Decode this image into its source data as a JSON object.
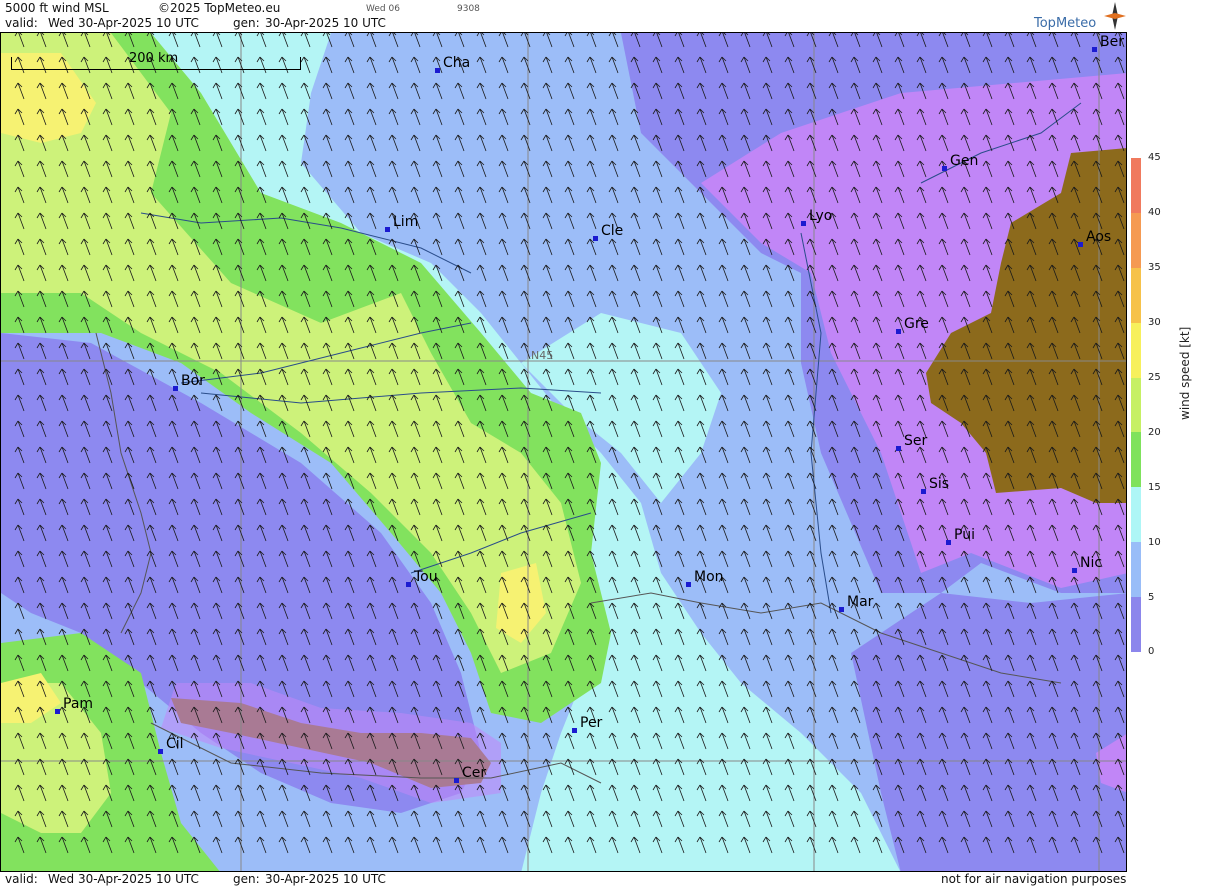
{
  "header": {
    "level": "5000 ft wind MSL",
    "copyright": "©2025 TopMeteo.eu",
    "day_short": "Wed 06",
    "code": "9308",
    "valid_label": "valid:",
    "valid_value": "Wed  30-Apr-2025  10 UTC",
    "gen_label": "gen:",
    "gen_value": "30-Apr-2025 10 UTC"
  },
  "footer": {
    "valid_label": "valid:",
    "valid_value": "Wed  30-Apr-2025  10 UTC",
    "gen_label": "gen:",
    "gen_value": "30-Apr-2025 10 UTC",
    "disclaimer": "not for air navigation purposes"
  },
  "brand": {
    "logo_text": "TopMeteo"
  },
  "map": {
    "scale_label": "200 km",
    "grid_label": "N45",
    "cities": [
      {
        "name": "Cha"
      },
      {
        "name": "Lim"
      },
      {
        "name": "Cle"
      },
      {
        "name": "Bor"
      },
      {
        "name": "Tou"
      },
      {
        "name": "Mon"
      },
      {
        "name": "Per"
      },
      {
        "name": "Cer"
      },
      {
        "name": "Pam"
      },
      {
        "name": "Cil"
      },
      {
        "name": "Lyo"
      },
      {
        "name": "Gen"
      },
      {
        "name": "Ber"
      },
      {
        "name": "Aos"
      },
      {
        "name": "Gre"
      },
      {
        "name": "Ser"
      },
      {
        "name": "Sis"
      },
      {
        "name": "Pui"
      },
      {
        "name": "Nic"
      },
      {
        "name": "Mar"
      }
    ],
    "wind_direction": "northwest"
  },
  "legend": {
    "title": "wind speed [kt]",
    "ticks": [
      "45",
      "40",
      "35",
      "30",
      "25",
      "20",
      "15",
      "10",
      "5",
      "0"
    ],
    "colors": [
      "#f07a5e",
      "#f59a52",
      "#f6c24a",
      "#f7f05c",
      "#c6f064",
      "#7fe25c",
      "#aef6f6",
      "#99bdf8",
      "#8c86ec",
      "#c786f6"
    ]
  },
  "colors": {
    "purple": "#c186f7",
    "violet": "#8d89f0",
    "blue": "#9cbdf8",
    "cyan": "#b4f5f5",
    "green": "#82e25e",
    "lime": "#cdf27a",
    "yellow": "#f6f272",
    "terrain": "#8c6a1c"
  }
}
